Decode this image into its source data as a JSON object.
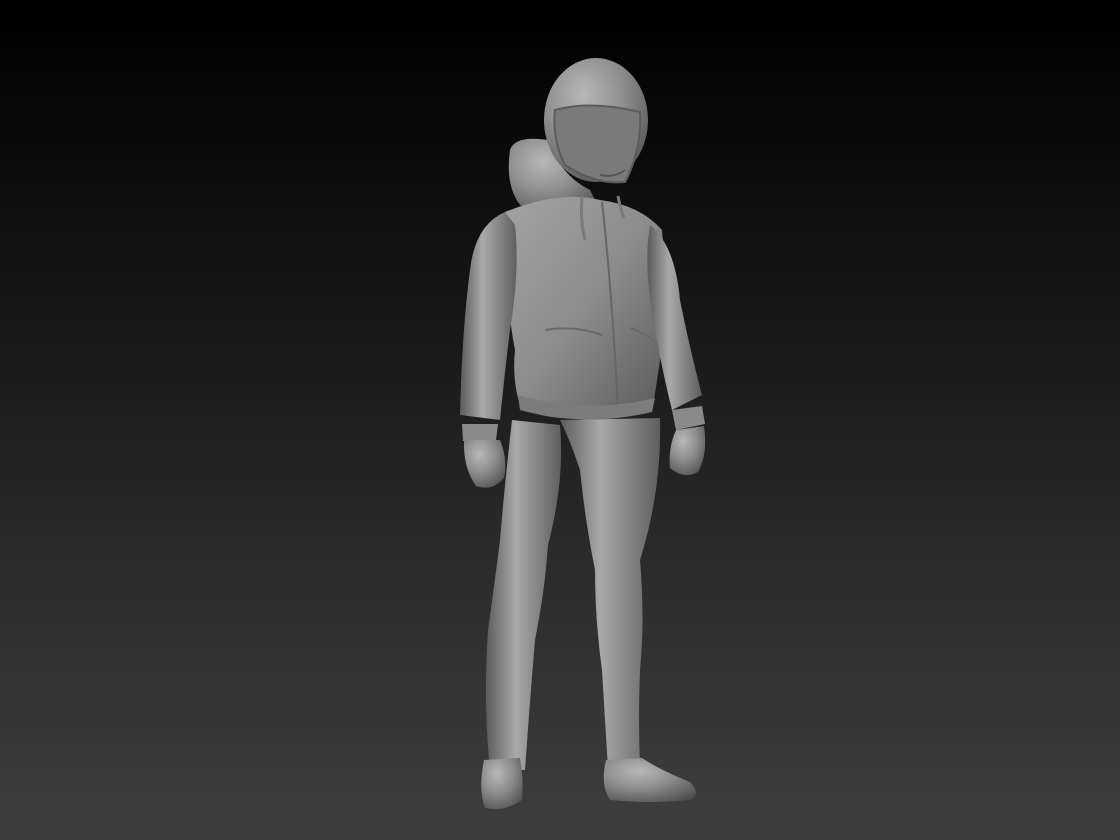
{
  "viewport": {
    "background_top": "#000000",
    "background_bottom": "#3e3e3e"
  },
  "model": {
    "subject": "sculpted-figure",
    "material_color": "#8f8f8f",
    "highlight_color": "#b4b4b4",
    "shadow_color": "#4a4a4a"
  }
}
